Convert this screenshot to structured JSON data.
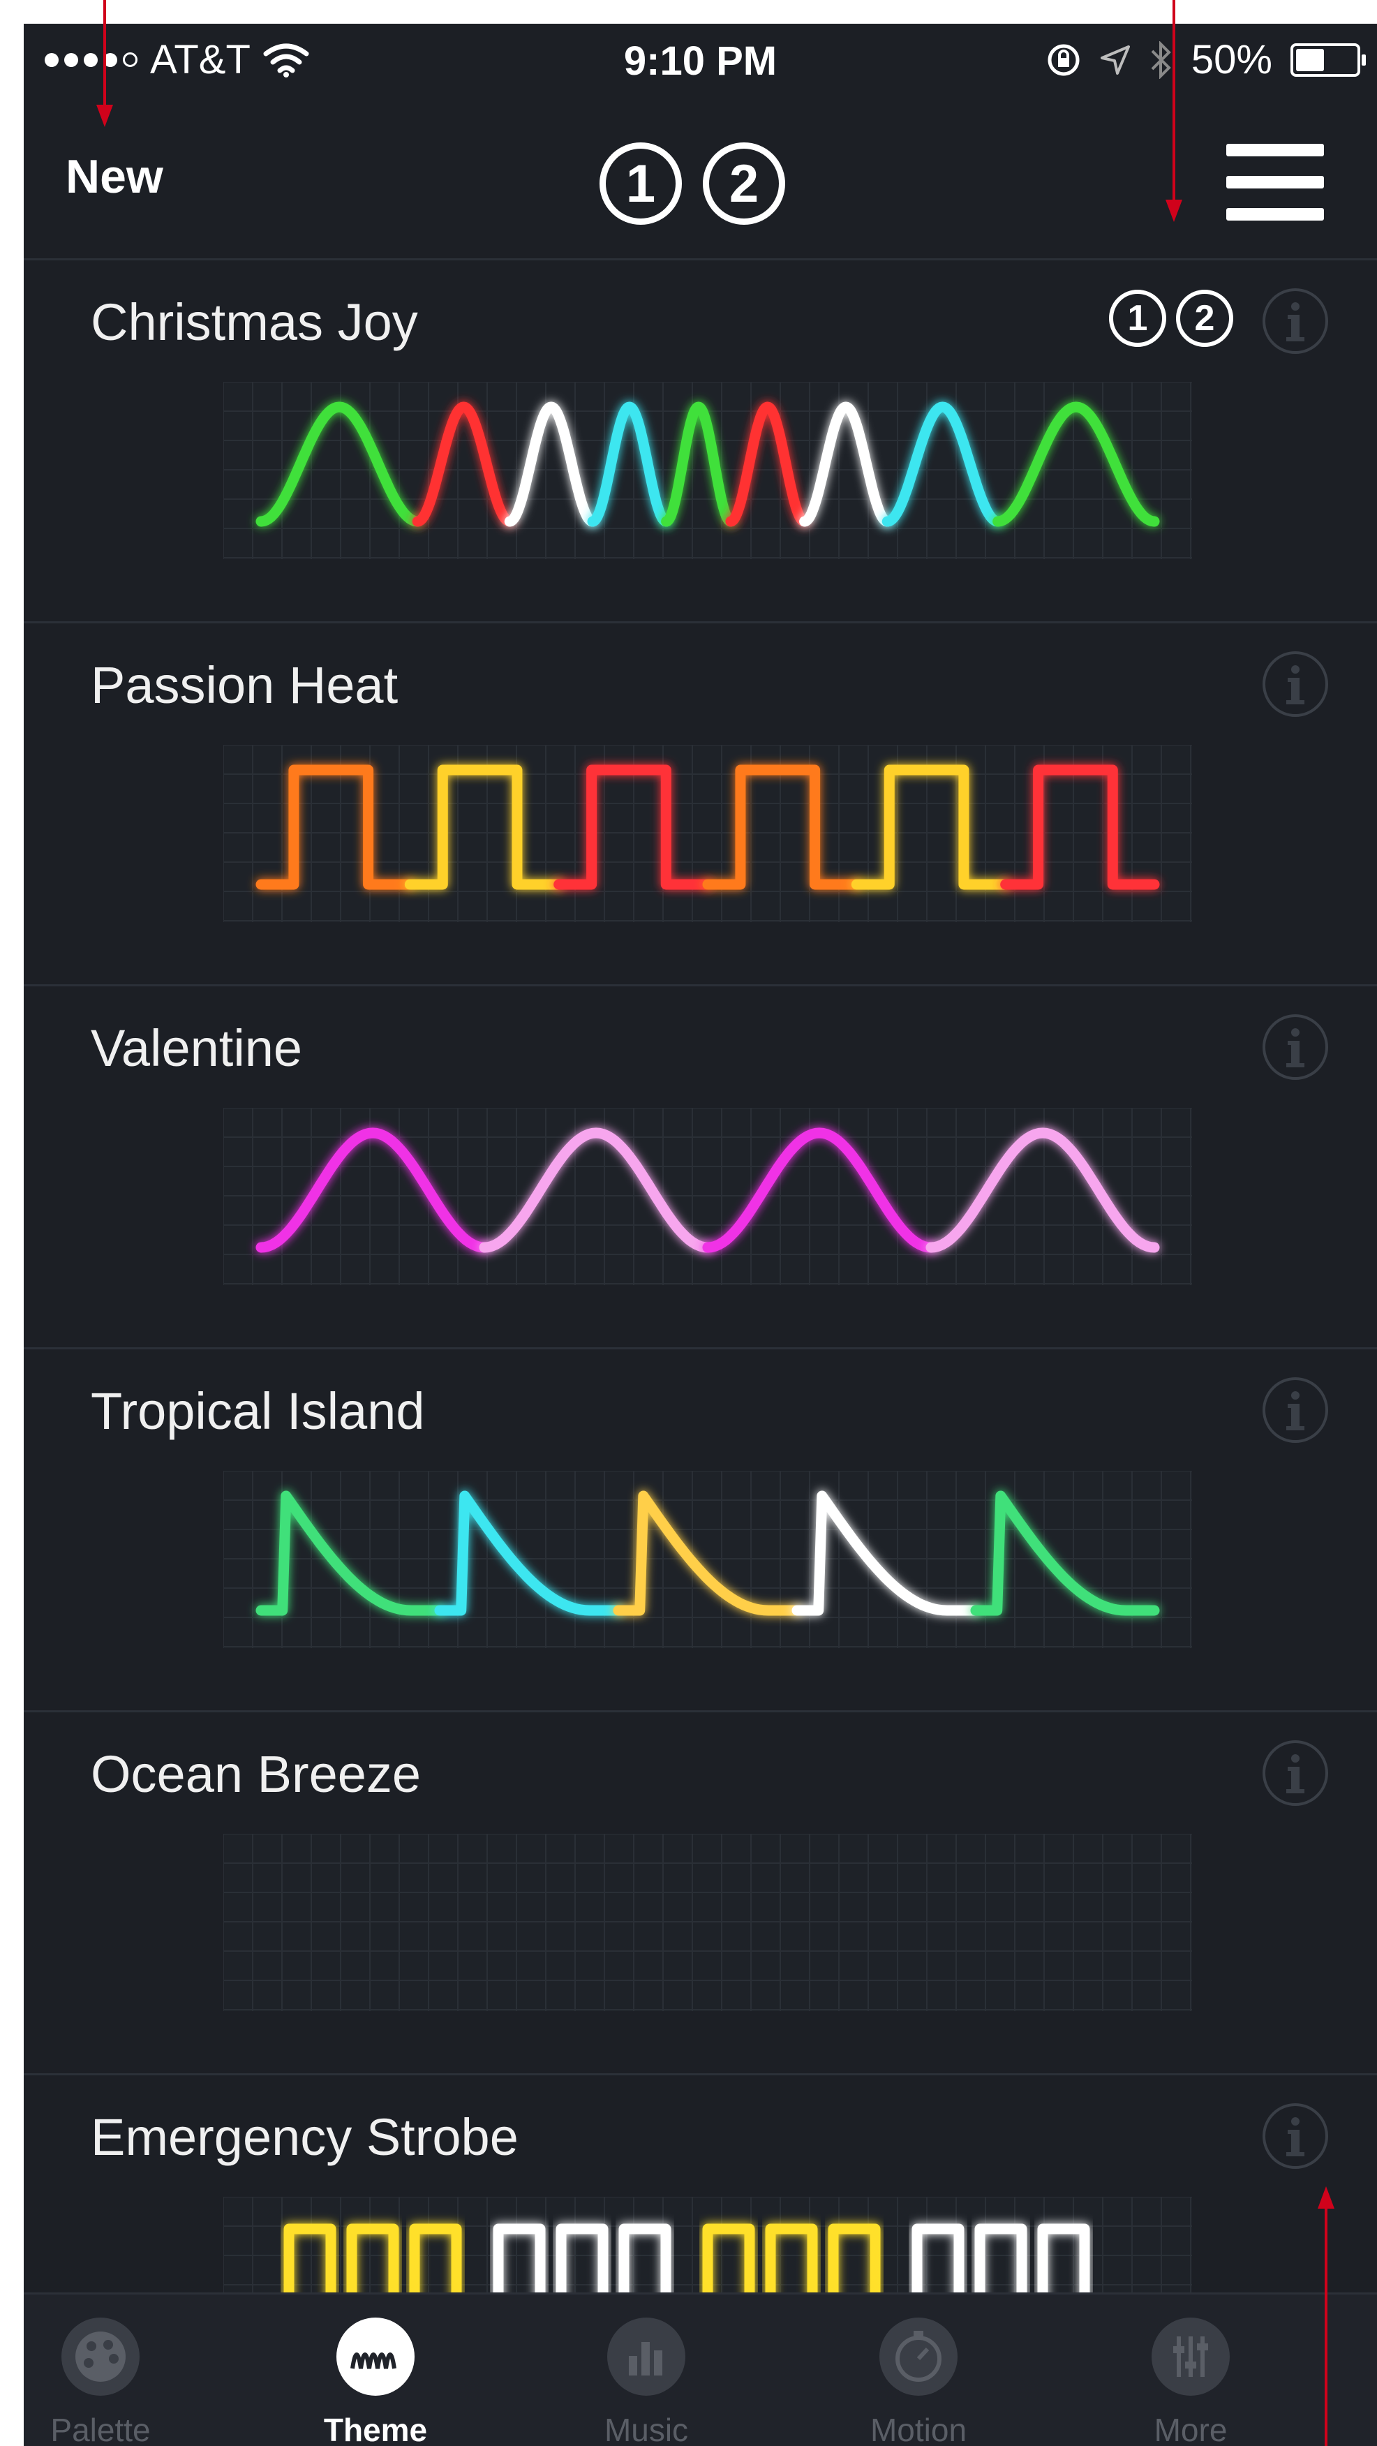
{
  "status_bar": {
    "carrier": "AT&T",
    "time": "9:10 PM",
    "battery": "50%"
  },
  "nav": {
    "new_label": "New",
    "group_1": "1",
    "group_2": "2"
  },
  "themes": [
    {
      "name": "Christmas Joy",
      "badges": [
        "1",
        "2"
      ],
      "wave": "sine-chirp",
      "colors": [
        "#3fe03a",
        "#ff3030",
        "#ffffff",
        "#3ee6f0",
        "#3fe03a",
        "#ff3030",
        "#ffffff",
        "#3ee6f0",
        "#3fe03a"
      ]
    },
    {
      "name": "Passion Heat",
      "badges": [],
      "wave": "square",
      "colors": [
        "#ff7a1a",
        "#ffd12a",
        "#ff3038",
        "#ff7a1a",
        "#ffd12a",
        "#ff3038"
      ]
    },
    {
      "name": "Valentine",
      "badges": [],
      "wave": "sine",
      "colors": [
        "#f032e6",
        "#f7a6ee",
        "#f032e6",
        "#f7a6ee"
      ]
    },
    {
      "name": "Tropical Island",
      "badges": [],
      "wave": "sawtooth",
      "colors": [
        "#3fe07a",
        "#3ee6f0",
        "#ffcf4a",
        "#ffffff",
        "#3fe07a"
      ]
    },
    {
      "name": "Ocean Breeze",
      "badges": [],
      "wave": "flat",
      "colors": [
        "#2e9ff5",
        "#ffffff",
        "#2e9ff5",
        "#ffffff"
      ]
    },
    {
      "name": "Emergency Strobe",
      "badges": [],
      "wave": "strobe",
      "colors": [
        "#ffe02a",
        "#ffffff",
        "#ffe02a",
        "#ffffff"
      ]
    }
  ],
  "tabs": [
    {
      "label": "Palette",
      "icon": "palette-icon",
      "active": false
    },
    {
      "label": "Theme",
      "icon": "wave-icon",
      "active": true
    },
    {
      "label": "Music",
      "icon": "equalizer-icon",
      "active": false
    },
    {
      "label": "Motion",
      "icon": "stopwatch-icon",
      "active": false
    },
    {
      "label": "More",
      "icon": "sliders-icon",
      "active": false
    }
  ],
  "annotation_color": "#d0021b"
}
